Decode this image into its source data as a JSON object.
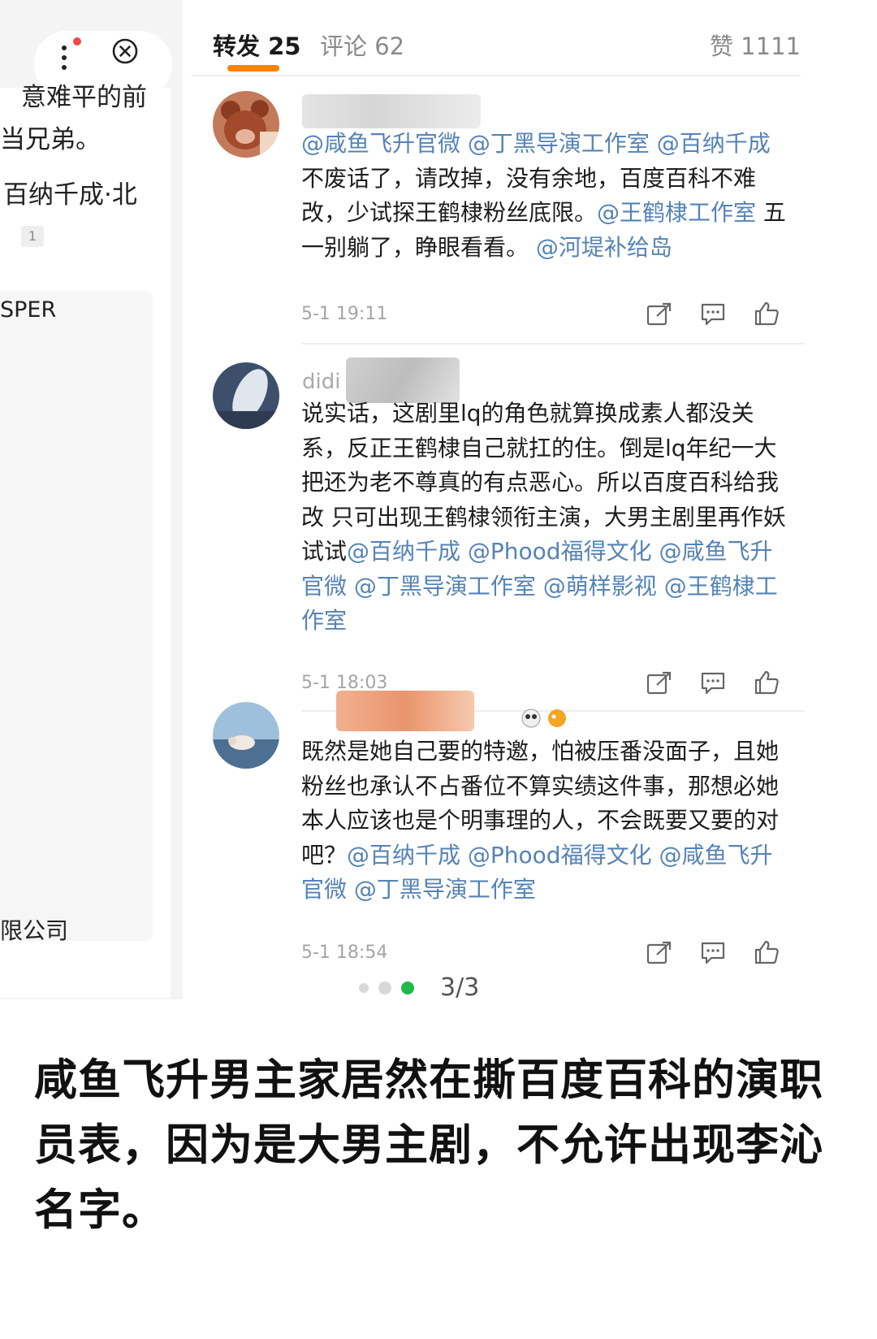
{
  "left_page": {
    "text_line_1": "意难平的前",
    "text_line_2": "当兄弟。",
    "text_line_3": "百纳千成·北",
    "badge_count": "1",
    "text_line_4": "SPER",
    "text_line_5": "限公司"
  },
  "tabs": {
    "reposts": "转发 25",
    "comments": "评论 62",
    "likes": "赞 1111"
  },
  "comments": [
    {
      "username": "",
      "segments": [
        {
          "t": "@咸鱼飞升官微 @丁黑导演工作室 @百纳千成",
          "m": true
        },
        {
          "t": " 不废话了，请改掉，没有余地，百度百科不难改，少试探王鹤棣粉丝底限。",
          "m": false
        },
        {
          "t": "@王鹤棣工作室",
          "m": true
        },
        {
          "t": " 五一别躺了，睁眼看看。 ",
          "m": false
        },
        {
          "t": "@河堤补给岛",
          "m": true
        }
      ],
      "time": "5-1 19:11"
    },
    {
      "username": "didi",
      "segments": [
        {
          "t": "说实话，这剧里lq的角色就算换成素人都没关系，反正王鹤棣自己就扛的住。倒是lq年纪一大把还为老不尊真的有点恶心。所以百度百科给我改 只可出现王鹤棣领衔主演，大男主剧里再作妖试试",
          "m": false
        },
        {
          "t": "@百纳千成 @Phood福得文化 @咸鱼飞升官微 @丁黑导演工作室 @萌样影视 @王鹤棣工作室",
          "m": true
        }
      ],
      "time": "5-1 18:03"
    },
    {
      "username": "",
      "segments": [
        {
          "t": "既然是她自己要的特邀，怕被压番没面子，且她粉丝也承认不占番位不算实绩这件事，那想必她本人应该也是个明事理的人，不会既要又要的对吧？",
          "m": false
        },
        {
          "t": "@百纳千成 @Phood福得文化 @咸鱼飞升官微 @丁黑导演工作室",
          "m": true
        }
      ],
      "time": "5-1 18:54"
    }
  ],
  "pager": {
    "indicator": "3/3",
    "active_color": "#1fb84a",
    "inactive_color": "#d8d8d8"
  },
  "caption": "咸鱼飞升男主家居然在撕百度百科的演职员表，因为是大男主剧，不允许出现李沁名字。",
  "colors": {
    "mention": "#5583b6",
    "tab_underline": "#ff8200"
  },
  "icons": [
    "more-icon",
    "close-icon",
    "repost-icon",
    "comment-icon",
    "like-icon"
  ]
}
